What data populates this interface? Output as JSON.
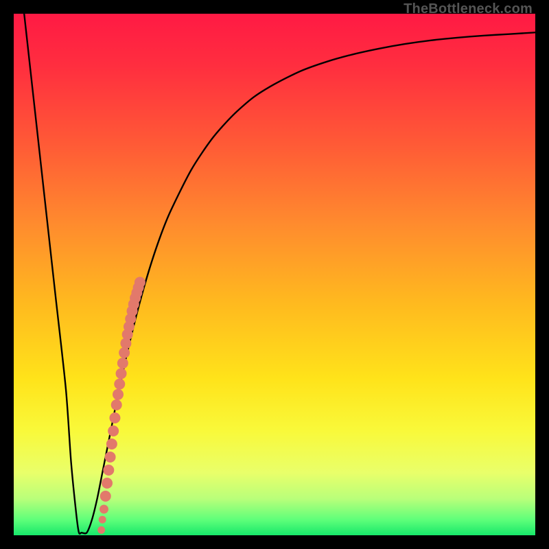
{
  "watermark": "TheBottleneck.com",
  "colors": {
    "frame": "#000000",
    "gradient_stops": [
      {
        "offset": 0.0,
        "color": "#ff1a44"
      },
      {
        "offset": 0.1,
        "color": "#ff2e3f"
      },
      {
        "offset": 0.25,
        "color": "#ff5a36"
      },
      {
        "offset": 0.4,
        "color": "#ff8a2e"
      },
      {
        "offset": 0.55,
        "color": "#ffb81f"
      },
      {
        "offset": 0.7,
        "color": "#ffe31a"
      },
      {
        "offset": 0.8,
        "color": "#f9f93a"
      },
      {
        "offset": 0.88,
        "color": "#e9ff6a"
      },
      {
        "offset": 0.93,
        "color": "#b9ff7a"
      },
      {
        "offset": 0.97,
        "color": "#5fff7a"
      },
      {
        "offset": 1.0,
        "color": "#17e86a"
      }
    ],
    "curve": "#000000",
    "dots": "#e2796b"
  },
  "chart_data": {
    "type": "line",
    "title": "",
    "xlabel": "",
    "ylabel": "",
    "xlim": [
      0,
      100
    ],
    "ylim": [
      0,
      100
    ],
    "grid": false,
    "legend": false,
    "series": [
      {
        "name": "bottleneck-curve",
        "x": [
          2,
          4,
          6,
          8,
          10,
          11,
          12,
          12.5,
          13,
          14,
          15,
          16,
          17,
          18,
          19,
          20,
          22,
          24,
          26,
          28,
          30,
          34,
          38,
          42,
          46,
          50,
          55,
          60,
          65,
          70,
          75,
          80,
          85,
          90,
          95,
          100
        ],
        "y": [
          100,
          82,
          64,
          46,
          28,
          14,
          4,
          0.5,
          0.5,
          0.5,
          3,
          7,
          12,
          17,
          22,
          27,
          36,
          44,
          51,
          57,
          62,
          70,
          76,
          80.5,
          84,
          86.5,
          89,
          90.8,
          92.2,
          93.3,
          94.2,
          94.9,
          95.4,
          95.8,
          96.1,
          96.4
        ]
      },
      {
        "name": "highlight-dots",
        "x": [
          16.8,
          17.0,
          17.3,
          17.6,
          17.9,
          18.2,
          18.5,
          18.8,
          19.1,
          19.4,
          19.7,
          20.0,
          20.3,
          20.6,
          20.9,
          21.2,
          21.5,
          21.8,
          22.1,
          22.4,
          22.7,
          23.0,
          23.3,
          23.6,
          23.9,
          24.2
        ],
        "y": [
          1.0,
          3.0,
          5.0,
          7.5,
          10.0,
          12.5,
          15.0,
          17.5,
          20.0,
          22.5,
          25.0,
          27.0,
          29.0,
          31.0,
          33.0,
          35.0,
          36.8,
          38.5,
          40.0,
          41.5,
          43.0,
          44.3,
          45.5,
          46.5,
          47.5,
          48.5
        ]
      }
    ]
  }
}
